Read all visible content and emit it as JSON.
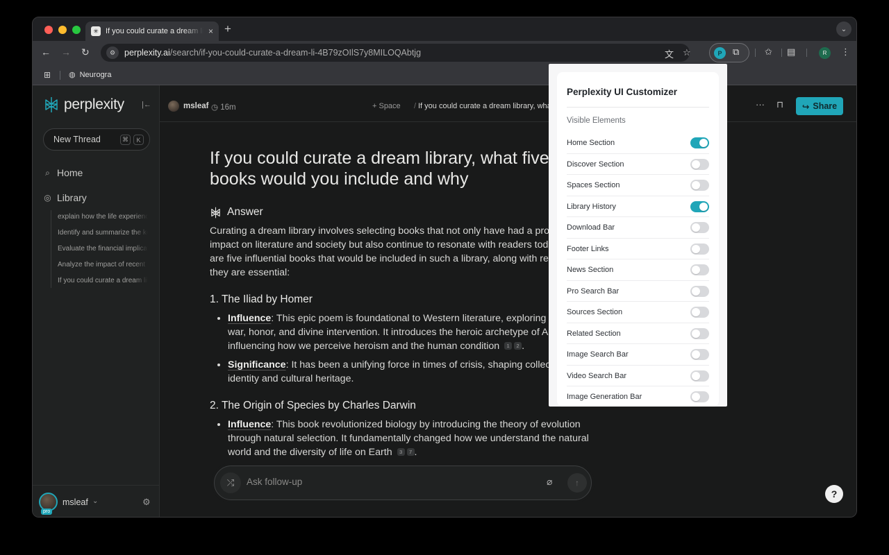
{
  "browser": {
    "tab_title": "If you could curate a dream lib",
    "tab_close": "×",
    "new_tab": "+",
    "url_host": "perplexity.ai",
    "url_path": "/search/if-you-could-curate-a-dream-li-4B79zOIlS7y8MILOQAbtjg",
    "profile_initial": "R",
    "extension_initial": "P",
    "bookmark": "Neurogra"
  },
  "sidebar": {
    "logo": "perplexity",
    "new_thread": "New Thread",
    "shortcut_keys": [
      "⌘",
      "K"
    ],
    "nav": [
      {
        "label": "Home",
        "icon": "search-icon"
      },
      {
        "label": "Library",
        "icon": "library-icon"
      }
    ],
    "history": [
      "explain how the life experiences",
      "Identify and summarize the key",
      "Evaluate the financial implications",
      "Analyze the impact of recent",
      "If you could curate a dream library"
    ],
    "user": "msleaf",
    "pro": "pro"
  },
  "header": {
    "author": "msleaf",
    "time": "16m",
    "space": "+ Space",
    "separator": "/",
    "thread_title": "If you could curate a dream library, what five",
    "share": "Share"
  },
  "content": {
    "title": "If you could curate a dream library, what five books would you include and why",
    "answer_label": "Answer",
    "intro": "Curating a dream library involves selecting books that not only have had a profound impact on literature and society but also continue to resonate with readers today. Here are five influential books that would be included in such a library, along with reasons why they are essential:",
    "sections": [
      {
        "heading": "1. The Iliad by Homer",
        "items": [
          {
            "label": "Influence",
            "text": ": This epic poem is foundational to Western literature, exploring themes of war, honor, and divine intervention. It introduces the heroic archetype of Achilles, influencing how we perceive heroism and the human condition",
            "cites": [
              "1",
              "2"
            ]
          },
          {
            "label": "Significance",
            "text": ": It has been a unifying force in times of crisis, shaping collective identity and cultural heritage.",
            "cites": []
          }
        ]
      },
      {
        "heading": "2. The Origin of Species by Charles Darwin",
        "items": [
          {
            "label": "Influence",
            "text": ": This book revolutionized biology by introducing the theory of evolution through natural selection. It fundamentally changed how we understand the natural world and the diversity of life on Earth",
            "cites": [
              "3",
              "7"
            ]
          }
        ]
      }
    ]
  },
  "ask": {
    "placeholder": "Ask follow-up"
  },
  "help": "?",
  "popup": {
    "title": "Perplexity UI Customizer",
    "subtitle": "Visible Elements",
    "toggles": [
      {
        "label": "Home Section",
        "on": true
      },
      {
        "label": "Discover Section",
        "on": false
      },
      {
        "label": "Spaces Section",
        "on": false
      },
      {
        "label": "Library History",
        "on": true
      },
      {
        "label": "Download Bar",
        "on": false
      },
      {
        "label": "Footer Links",
        "on": false
      },
      {
        "label": "News Section",
        "on": false
      },
      {
        "label": "Pro Search Bar",
        "on": false
      },
      {
        "label": "Sources Section",
        "on": false
      },
      {
        "label": "Related Section",
        "on": false
      },
      {
        "label": "Image Search Bar",
        "on": false
      },
      {
        "label": "Video Search Bar",
        "on": false
      },
      {
        "label": "Image Generation Bar",
        "on": false
      }
    ]
  },
  "colors": {
    "accent": "#20a6b8",
    "page_bg": "#191a1a",
    "sidebar_bg": "#202222",
    "traffic_red": "#ff5f57",
    "traffic_yellow": "#febc2e",
    "traffic_green": "#28c840"
  }
}
